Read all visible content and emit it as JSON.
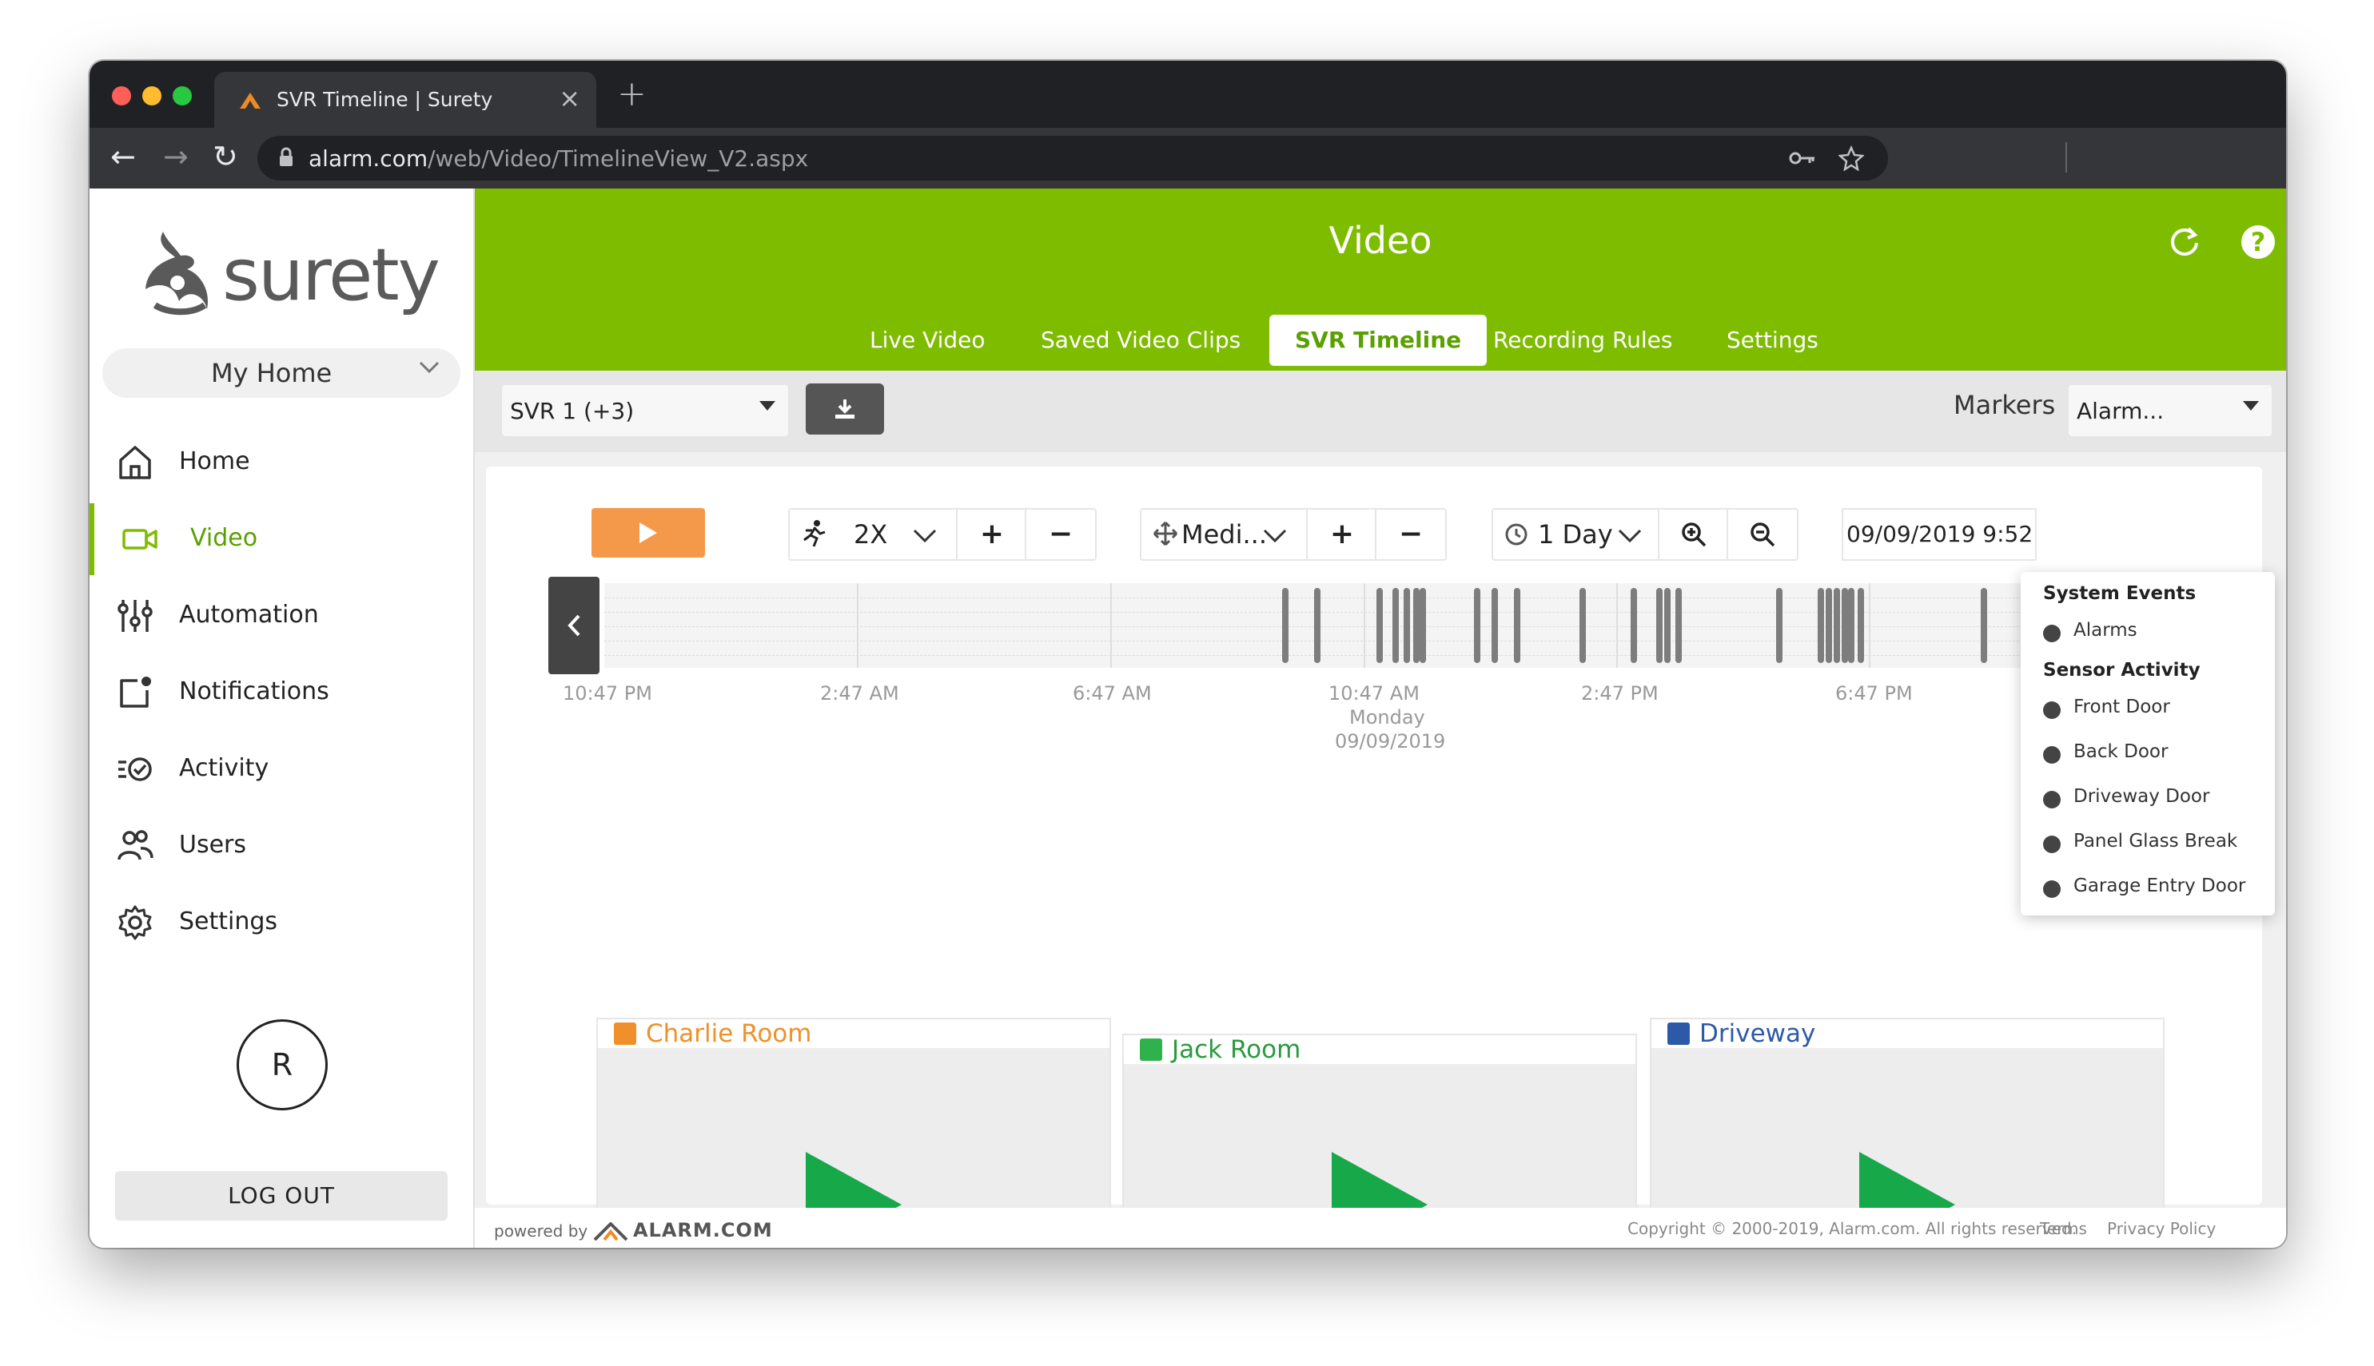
{
  "browser": {
    "tab_title": "SVR Timeline | Surety",
    "url_host": "alarm.com",
    "url_path": "/web/Video/TimelineView_V2.aspx",
    "close_glyph": "×",
    "newtab_glyph": "+",
    "back_glyph": "←",
    "forward_glyph": "→",
    "reload_glyph": "↻"
  },
  "brand": {
    "name": "surety",
    "accent": "#7ebc00"
  },
  "sidebar": {
    "location": "My Home",
    "items": [
      {
        "label": "Home",
        "icon": "home-icon"
      },
      {
        "label": "Video",
        "icon": "video-camera-icon",
        "active": true
      },
      {
        "label": "Automation",
        "icon": "sliders-icon"
      },
      {
        "label": "Notifications",
        "icon": "notification-icon"
      },
      {
        "label": "Activity",
        "icon": "activity-icon"
      },
      {
        "label": "Users",
        "icon": "users-icon"
      },
      {
        "label": "Settings",
        "icon": "gear-icon"
      }
    ],
    "avatar_initial": "R",
    "logout": "LOG OUT"
  },
  "header": {
    "title": "Video",
    "tabs": [
      {
        "label": "Live Video"
      },
      {
        "label": "Saved Video Clips"
      },
      {
        "label": "SVR Timeline",
        "active": true
      },
      {
        "label": "Recording Rules"
      },
      {
        "label": "Settings"
      }
    ],
    "help_glyph": "?"
  },
  "controls": {
    "svr_select": "SVR 1 (+3)",
    "markers_label": "Markers",
    "markers_value": "Alarm...",
    "speed": "2X",
    "density": "Medi...",
    "range": "1 Day",
    "date": "09/09/2019 9:52",
    "plus_glyph": "+",
    "minus_glyph": "−"
  },
  "timeline": {
    "labels": [
      "10:47 PM",
      "2:47 AM",
      "6:47 AM",
      "10:47 AM",
      "2:47 PM",
      "6:47 PM"
    ],
    "day_label": "Monday",
    "date_label": "09/09/2019"
  },
  "cameras": [
    {
      "name": "Charlie Room",
      "color": "#f0902a",
      "text_color": "#f0902a"
    },
    {
      "name": "Jack Room",
      "color": "#2fb24c",
      "text_color": "#2a9a3e"
    },
    {
      "name": "Driveway",
      "color": "#2c5aa8",
      "text_color": "#2c5aa8"
    }
  ],
  "markers_dropdown": {
    "system_heading": "System Events",
    "system_items": [
      "Alarms"
    ],
    "sensor_heading": "Sensor Activity",
    "sensor_items": [
      "Front Door",
      "Back Door",
      "Driveway Door",
      "Panel Glass Break",
      "Garage Entry Door"
    ]
  },
  "footer": {
    "powered_by": "powered by",
    "powered_brand": "ALARM.COM",
    "copyright": "Copyright © 2000-2019, Alarm.com. All rights reserved.",
    "terms": "Terms",
    "privacy": "Privacy Policy"
  }
}
